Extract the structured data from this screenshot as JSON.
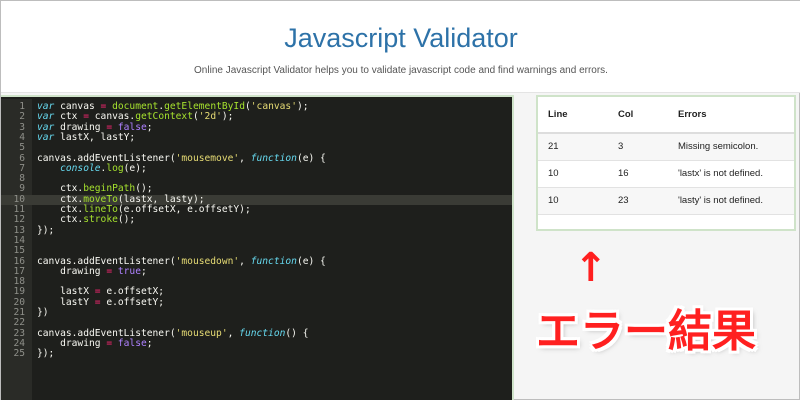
{
  "header": {
    "title": "Javascript Validator",
    "subtitle": "Online Javascript Validator helps you to validate javascript code and find warnings and errors."
  },
  "editor": {
    "active_line": 10,
    "lines": [
      {
        "n": "1",
        "tokens": [
          [
            "k",
            "var"
          ],
          [
            "p",
            " canvas "
          ],
          [
            "o",
            "="
          ],
          [
            "p",
            " "
          ],
          [
            "f",
            "document"
          ],
          [
            "p",
            "."
          ],
          [
            "f",
            "getElementById"
          ],
          [
            "p",
            "("
          ],
          [
            "s",
            "'canvas'"
          ],
          [
            "p",
            ");"
          ]
        ]
      },
      {
        "n": "2",
        "tokens": [
          [
            "k",
            "var"
          ],
          [
            "p",
            " ctx "
          ],
          [
            "o",
            "="
          ],
          [
            "p",
            " canvas."
          ],
          [
            "f",
            "getContext"
          ],
          [
            "p",
            "("
          ],
          [
            "s",
            "'2d'"
          ],
          [
            "p",
            ");"
          ]
        ]
      },
      {
        "n": "3",
        "tokens": [
          [
            "k",
            "var"
          ],
          [
            "p",
            " drawing "
          ],
          [
            "o",
            "="
          ],
          [
            "p",
            " "
          ],
          [
            "b",
            "false"
          ],
          [
            "p",
            ";"
          ]
        ]
      },
      {
        "n": "4",
        "tokens": [
          [
            "k",
            "var"
          ],
          [
            "p",
            " lastX, lastY;"
          ]
        ]
      },
      {
        "n": "5",
        "tokens": []
      },
      {
        "n": "6",
        "tokens": [
          [
            "p",
            "canvas.addEventListener("
          ],
          [
            "s",
            "'mousemove'"
          ],
          [
            "p",
            ", "
          ],
          [
            "k",
            "function"
          ],
          [
            "p",
            "(e) {"
          ]
        ]
      },
      {
        "n": "7",
        "tokens": [
          [
            "p",
            "    "
          ],
          [
            "k",
            "console"
          ],
          [
            "p",
            "."
          ],
          [
            "f",
            "log"
          ],
          [
            "p",
            "(e);"
          ]
        ]
      },
      {
        "n": "8",
        "tokens": []
      },
      {
        "n": "9",
        "tokens": [
          [
            "p",
            "    ctx."
          ],
          [
            "f",
            "beginPath"
          ],
          [
            "p",
            "();"
          ]
        ]
      },
      {
        "n": "10",
        "tokens": [
          [
            "p",
            "    ctx."
          ],
          [
            "f",
            "moveTo"
          ],
          [
            "p",
            "(lastx, lasty);"
          ]
        ]
      },
      {
        "n": "11",
        "tokens": [
          [
            "p",
            "    ctx."
          ],
          [
            "f",
            "lineTo"
          ],
          [
            "p",
            "(e.offsetX, e.offsetY);"
          ]
        ]
      },
      {
        "n": "12",
        "tokens": [
          [
            "p",
            "    ctx."
          ],
          [
            "f",
            "stroke"
          ],
          [
            "p",
            "();"
          ]
        ]
      },
      {
        "n": "13",
        "tokens": [
          [
            "p",
            "});"
          ]
        ]
      },
      {
        "n": "14",
        "tokens": []
      },
      {
        "n": "15",
        "tokens": []
      },
      {
        "n": "16",
        "tokens": [
          [
            "p",
            "canvas.addEventListener("
          ],
          [
            "s",
            "'mousedown'"
          ],
          [
            "p",
            ", "
          ],
          [
            "k",
            "function"
          ],
          [
            "p",
            "(e) {"
          ]
        ]
      },
      {
        "n": "17",
        "tokens": [
          [
            "p",
            "    drawing "
          ],
          [
            "o",
            "="
          ],
          [
            "p",
            " "
          ],
          [
            "b",
            "true"
          ],
          [
            "p",
            ";"
          ]
        ]
      },
      {
        "n": "18",
        "tokens": []
      },
      {
        "n": "19",
        "tokens": [
          [
            "p",
            "    lastX "
          ],
          [
            "o",
            "="
          ],
          [
            "p",
            " e.offsetX;"
          ]
        ]
      },
      {
        "n": "20",
        "tokens": [
          [
            "p",
            "    lastY "
          ],
          [
            "o",
            "="
          ],
          [
            "p",
            " e.offsetY;"
          ]
        ]
      },
      {
        "n": "21",
        "tokens": [
          [
            "p",
            "})"
          ]
        ]
      },
      {
        "n": "22",
        "tokens": []
      },
      {
        "n": "23",
        "tokens": [
          [
            "p",
            "canvas.addEventListener("
          ],
          [
            "s",
            "'mouseup'"
          ],
          [
            "p",
            ", "
          ],
          [
            "k",
            "function"
          ],
          [
            "p",
            "() {"
          ]
        ]
      },
      {
        "n": "24",
        "tokens": [
          [
            "p",
            "    drawing "
          ],
          [
            "o",
            "="
          ],
          [
            "p",
            " "
          ],
          [
            "b",
            "false"
          ],
          [
            "p",
            ";"
          ]
        ]
      },
      {
        "n": "25",
        "tokens": [
          [
            "p",
            "});"
          ]
        ]
      }
    ]
  },
  "results": {
    "columns": [
      "Line",
      "Col",
      "Errors"
    ],
    "rows": [
      [
        "21",
        "3",
        "Missing semicolon."
      ],
      [
        "10",
        "16",
        "'lastx' is not defined."
      ],
      [
        "10",
        "23",
        "'lasty' is not defined."
      ]
    ]
  },
  "annotation": {
    "arrow": "↑",
    "label": "エラー結果"
  },
  "colors": {
    "title": "#2d72a8",
    "editor_bg": "#1e1f1c",
    "keyword": "#66d9ef",
    "string": "#e6db74",
    "function": "#a6e22e",
    "operator": "#f92672",
    "annotation": "#ff2020"
  }
}
